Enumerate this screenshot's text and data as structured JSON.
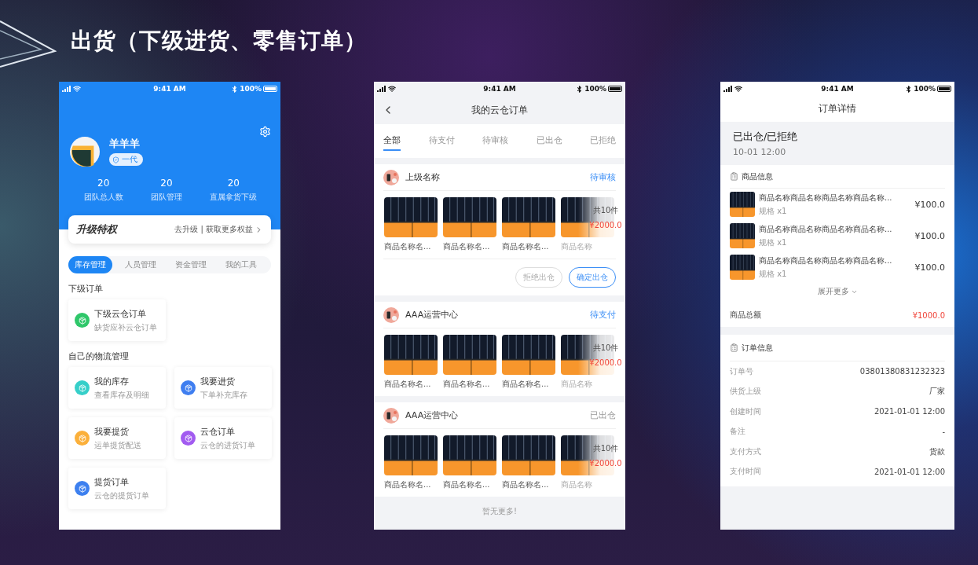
{
  "title": "出货（下级进货、零售订单）",
  "profile_screen": {
    "status_bar": {
      "time": "9:41 AM",
      "battery": "100%"
    },
    "user": {
      "name": "羊羊羊",
      "badge": "一代"
    },
    "stats": [
      {
        "value": "20",
        "label": "团队总人数"
      },
      {
        "value": "20",
        "label": "团队管理"
      },
      {
        "value": "20",
        "label": "直属拿货下级"
      }
    ],
    "upgrade": {
      "title": "升级特权",
      "link": "去升级 | 获取更多权益"
    },
    "tabs": [
      {
        "label": "库存管理",
        "selected": true
      },
      {
        "label": "人员管理",
        "selected": false
      },
      {
        "label": "资金管理",
        "selected": false
      },
      {
        "label": "我的工具",
        "selected": false
      }
    ],
    "sections": [
      {
        "heading": "下级订单",
        "items": [
          {
            "title": "下级云仓订单",
            "subtitle": "缺货应补云仓订单",
            "color": "#2fc76a"
          }
        ]
      },
      {
        "heading": "自己的物流管理",
        "items": [
          {
            "title": "我的库存",
            "subtitle": "查看库存及明细",
            "color": "#36cfc9"
          },
          {
            "title": "我要进货",
            "subtitle": "下单补充库存",
            "color": "#3f7ef0"
          },
          {
            "title": "我要提货",
            "subtitle": "运单提货配送",
            "color": "#fbb03b"
          },
          {
            "title": "云仓订单",
            "subtitle": "云仓的进货订单",
            "color": "#a25bf0"
          },
          {
            "title": "提货订单",
            "subtitle": "云仓的提货订单",
            "color": "#3d80ef"
          }
        ]
      }
    ]
  },
  "orders_screen": {
    "status_bar": {
      "time": "9:41 AM",
      "battery": "100%"
    },
    "title": "我的云仓订单",
    "tabs": [
      {
        "label": "全部",
        "selected": true
      },
      {
        "label": "待支付",
        "selected": false
      },
      {
        "label": "待审核",
        "selected": false
      },
      {
        "label": "已出仓",
        "selected": false
      },
      {
        "label": "已拒绝",
        "selected": false
      }
    ],
    "orders": [
      {
        "shop": "上级名称",
        "status": "待审核",
        "highlight": true,
        "products": [
          "商品名称名...",
          "商品名称名...",
          "商品名称名...",
          "商品名称"
        ],
        "count": "共10件",
        "total": "¥2000.0",
        "actions": [
          {
            "label": "拒绝出仓",
            "primary": false
          },
          {
            "label": "确定出仓",
            "primary": true
          }
        ]
      },
      {
        "shop": "AAA运营中心",
        "status": "待支付",
        "highlight": true,
        "products": [
          "商品名称名...",
          "商品名称名...",
          "商品名称名...",
          "商品名称"
        ],
        "count": "共10件",
        "total": "¥2000.0"
      },
      {
        "shop": "AAA运营中心",
        "status": "已出仓",
        "highlight": false,
        "products": [
          "商品名称名...",
          "商品名称名...",
          "商品名称名...",
          "商品名称"
        ],
        "count": "共10件",
        "total": "¥2000.0"
      }
    ],
    "footer": "暂无更多!"
  },
  "detail_screen": {
    "status_bar": {
      "time": "9:41 AM",
      "battery": "100%"
    },
    "title": "订单详情",
    "status": "已出仓/已拒绝",
    "time": "10-01 12:00",
    "goods": {
      "heading": "商品信息",
      "items": [
        {
          "name": "商品名称商品名称商品名称商品名称...",
          "spec": "规格 x1",
          "price": "¥100.0"
        },
        {
          "name": "商品名称商品名称商品名称商品名称...",
          "spec": "规格 x1",
          "price": "¥100.0"
        },
        {
          "name": "商品名称商品名称商品名称商品名称...",
          "spec": "规格 x1",
          "price": "¥100.0"
        }
      ],
      "expand": "展开更多",
      "total_label": "商品总额",
      "total": "¥1000.0"
    },
    "info": {
      "heading": "订单信息",
      "rows": [
        {
          "label": "订单号",
          "value": "03801380831232323"
        },
        {
          "label": "供货上级",
          "value": "厂家"
        },
        {
          "label": "创建时间",
          "value": "2021-01-01 12:00"
        },
        {
          "label": "备注",
          "value": "-"
        },
        {
          "label": "支付方式",
          "value": "货款"
        },
        {
          "label": "支付时间",
          "value": "2021-01-01 12:00"
        }
      ]
    }
  }
}
